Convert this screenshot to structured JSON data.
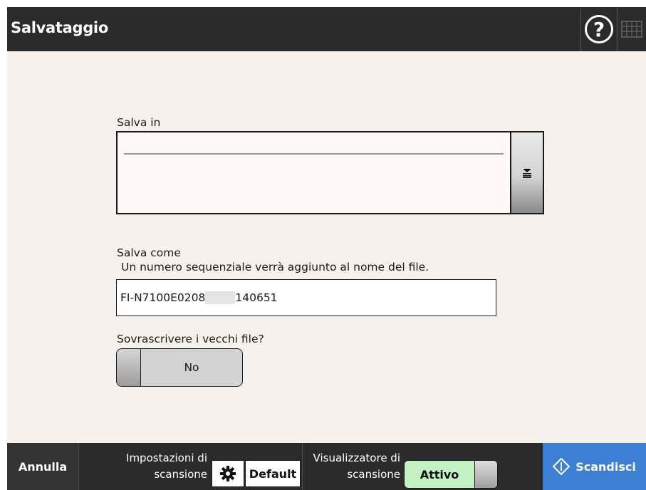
{
  "header": {
    "title": "Salvataggio",
    "help_glyph": "?",
    "help_icon": "help-circle-icon",
    "keyboard_icon": "keyboard-icon"
  },
  "save_in": {
    "label": "Salva in",
    "dropdown_icon": "expand-list-icon"
  },
  "save_as": {
    "label": "Salva come",
    "hint": "Un numero sequenziale verrà aggiunto al nome del file.",
    "value_prefix": "FI-N7100E0208",
    "value_suffix": "140651"
  },
  "overwrite": {
    "label": "Sovrascrivere i vecchi file?",
    "value": "No"
  },
  "footer": {
    "cancel_label": "Annulla",
    "scan_settings_caption_line1": "Impostazioni di",
    "scan_settings_caption_line2": "scansione",
    "scan_settings_icon": "gear-icon",
    "scan_settings_value": "Default",
    "viewer_caption_line1": "Visualizzatore di",
    "viewer_caption_line2": "scansione",
    "viewer_value": "Attivo",
    "scan_label": "Scandisci",
    "scan_icon": "scan-diamond-icon"
  },
  "colors": {
    "header_bg": "#2b2b2b",
    "content_bg": "#f7f1ee",
    "scan_button_bg": "#3e7fd6",
    "active_toggle_bg": "#c4f1c4"
  }
}
